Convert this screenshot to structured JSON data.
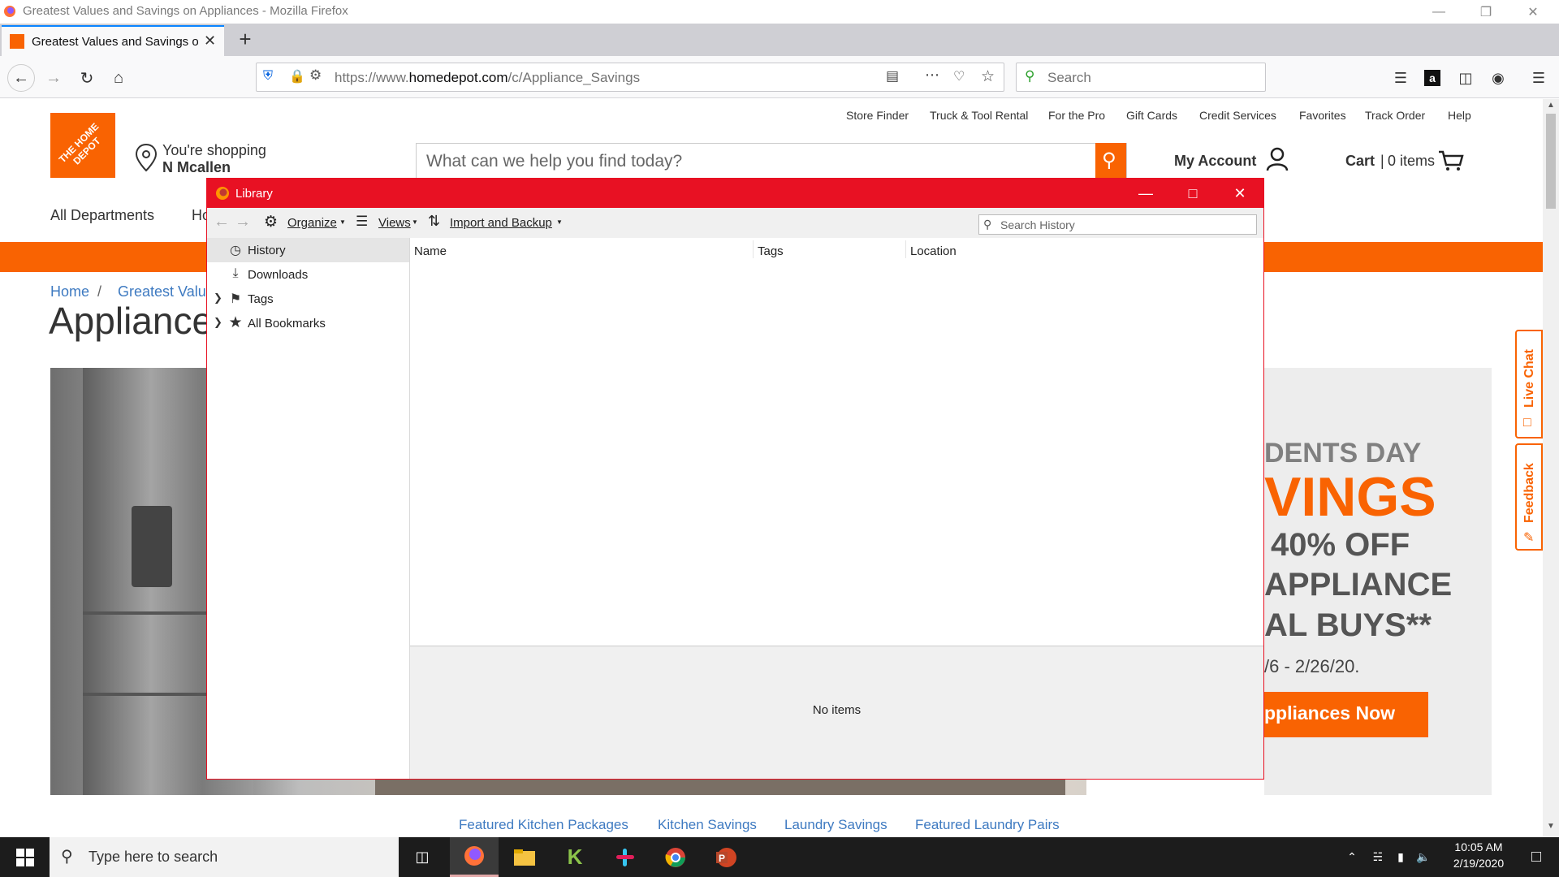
{
  "window": {
    "title": "Greatest Values and Savings on Appliances - Mozilla Firefox",
    "controls": [
      "minimize",
      "restore",
      "close"
    ]
  },
  "tab": {
    "label": "Greatest Values and Savings on Appliances",
    "new_tab_symbol": "+"
  },
  "navbar": {
    "url_prefix": "https://www.",
    "url_domain": "homedepot.com",
    "url_path": "/c/Appliance_Savings",
    "search_placeholder": "Search"
  },
  "site": {
    "top_links": [
      "Store Finder",
      "Truck & Tool Rental",
      "For the Pro",
      "Gift Cards",
      "Credit Services",
      "Favorites",
      "Track Order",
      "Help"
    ],
    "logo_text": "THE HOME DEPOT",
    "shopping_line1": "You're shopping",
    "shopping_line2": "N Mcallen",
    "search_placeholder": "What can we help you find today?",
    "account_label": "My Account",
    "cart_label": "Cart",
    "cart_items": "0 items",
    "nav_all": "All Departments",
    "nav_partial": "Ho",
    "breadcrumb_home": "Home",
    "breadcrumb_sep": "/",
    "breadcrumb_current": "Greatest Value",
    "page_title": "Appliance",
    "bottom_links": [
      "Featured Kitchen Packages",
      "Kitchen Savings",
      "Laundry Savings",
      "Featured Laundry Pairs"
    ]
  },
  "promo": {
    "line1": "DENTS DAY",
    "line2": "VINGS",
    "line3": "40% OFF",
    "line4": "APPLIANCE",
    "line5": "AL BUYS**",
    "dates": "/6 - 2/26/20.",
    "button": "ppliances Now"
  },
  "side_tabs": {
    "live_chat": "Live Chat",
    "feedback": "Feedback"
  },
  "library": {
    "title": "Library",
    "toolbar": {
      "organize": "Organize",
      "views": "Views",
      "import_backup": "Import and Backup",
      "search_placeholder": "Search History"
    },
    "tree": [
      {
        "label": "History",
        "icon": "clock-icon"
      },
      {
        "label": "Downloads",
        "icon": "download-icon"
      },
      {
        "label": "Tags",
        "icon": "tag-icon"
      },
      {
        "label": "All Bookmarks",
        "icon": "star-icon"
      }
    ],
    "columns": [
      "Name",
      "Tags",
      "Location"
    ],
    "details_message": "No items"
  },
  "taskbar": {
    "search_placeholder": "Type here to search",
    "time": "10:05 AM",
    "date": "2/19/2020"
  },
  "colors": {
    "brand_orange": "#f96302",
    "library_titlebar": "#e81123",
    "link_blue": "#3e7ac1"
  }
}
